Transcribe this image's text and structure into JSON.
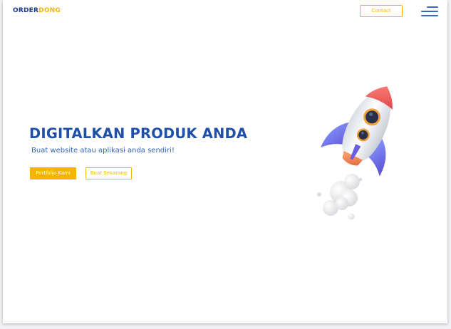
{
  "header": {
    "logo_part1": "ORDER",
    "logo_part2": "DONG",
    "contact_label": "Contact",
    "menu_icon": "hamburger-menu-icon"
  },
  "hero": {
    "title": "DIGITALKAN PRODUK ANDA",
    "subtitle": "Buat website atau aplikasi anda sendiri!",
    "primary_button": "Portfolio Kami",
    "secondary_button": "Buat Sekarang",
    "illustration": "rocket-illustration"
  },
  "colors": {
    "brand_dark": "#1e3a8a",
    "brand_accent": "#f5b400",
    "heading_blue": "#1f4fa8",
    "menu_blue": "#3b66c4"
  }
}
